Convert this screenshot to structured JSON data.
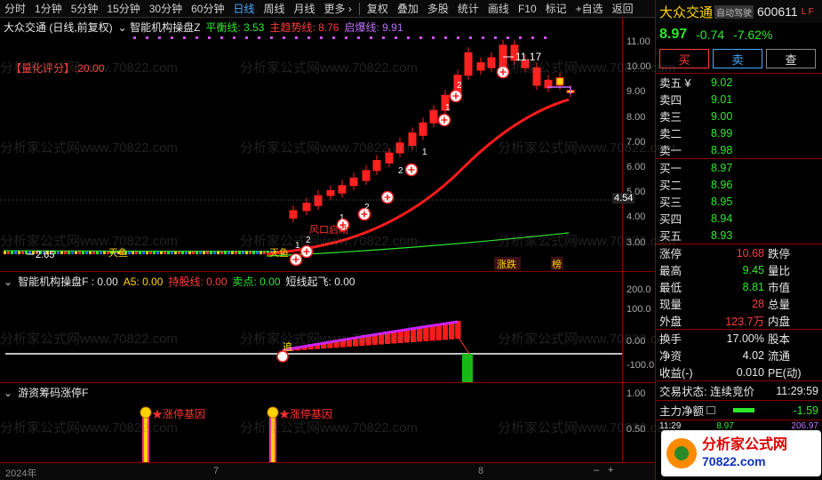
{
  "toolbar": {
    "items": [
      "分时",
      "1分钟",
      "5分钟",
      "15分钟",
      "30分钟",
      "60分钟",
      "日线",
      "周线",
      "月线",
      "更多 ›",
      "复权",
      "叠加",
      "多股",
      "统计",
      "画线",
      "F10",
      "标记",
      "+自选",
      "返回"
    ],
    "active_index": 6
  },
  "main": {
    "stock_title": "大众交通 (日线,前复权)",
    "indicator_name": "智能机构操盘Z",
    "pingheng": "平衡线: 3.53",
    "zhuqushi": "主趋势线: 8.76",
    "qibao": "启爆线: 9.91",
    "score": "【量化评分】:20.00",
    "price_labels": [
      "11.00",
      "10.00",
      "9.00",
      "8.00",
      "7.00",
      "6.00",
      "5.00",
      "4.00",
      "3.00"
    ],
    "current_price_tag": "4.54",
    "high_label": "11.17",
    "low_label": "2.65",
    "fengkou": "风口启动",
    "zhangdie": "涨跌",
    "bang": "榜",
    "tianyu": "天鱼",
    "watermark": "分析家公式网www.70822.com"
  },
  "sub1": {
    "header": [
      "智能机构操盘F : 0.00",
      "A5: 0.00",
      "持股线: 0.00",
      "卖点: 0.00",
      "短线起飞: 0.00"
    ],
    "axis": [
      "200.0",
      "100.0",
      "0.00",
      "-100.0"
    ],
    "zhui": "追"
  },
  "sub2": {
    "header": "游资筹码涨停F",
    "label": "★涨停基因",
    "axis": [
      "1.00",
      "0.50"
    ]
  },
  "timeaxis": {
    "labels": [
      "2024年",
      "7",
      "8"
    ]
  },
  "right": {
    "name": "大众交通",
    "tag": "自动驾驶",
    "code": "600611",
    "flags": "L F",
    "price": "8.97",
    "change": "-0.74",
    "pct": "-7.62%",
    "buy": "买",
    "sell": "卖",
    "query": "查",
    "sells": [
      {
        "label": "卖五 ¥",
        "price": "9.02"
      },
      {
        "label": "卖四",
        "price": "9.01"
      },
      {
        "label": "卖三",
        "price": "9.00"
      },
      {
        "label": "卖二",
        "price": "8.99"
      },
      {
        "label": "卖一",
        "price": "8.98"
      }
    ],
    "buys": [
      {
        "label": "买一",
        "price": "8.97"
      },
      {
        "label": "买二",
        "price": "8.96"
      },
      {
        "label": "买三",
        "price": "8.95"
      },
      {
        "label": "买四",
        "price": "8.94"
      },
      {
        "label": "买五",
        "price": "8.93"
      }
    ],
    "stats": [
      {
        "l": "涨停",
        "v": "10.68",
        "r": "跌停"
      },
      {
        "l": "最高",
        "v": "9.45",
        "r": "量比"
      },
      {
        "l": "最低",
        "v": "8.81",
        "r": "市值"
      },
      {
        "l": "现量",
        "v": "28",
        "r": "总量"
      },
      {
        "l": "外盘",
        "v": "123.7万",
        "r": "内盘"
      }
    ],
    "stats2": [
      {
        "l": "换手",
        "v": "17.00%",
        "r": "股本"
      },
      {
        "l": "净资",
        "v": "4.02",
        "r": "流通"
      },
      {
        "l": "收益(-)",
        "v": "0.010",
        "r": "PE(动)"
      }
    ],
    "trade_state": "交易状态: 连续竞价",
    "time": "11:29:59",
    "fund_label": "主力净额",
    "fund_value": "-1.59",
    "tick_time": "11:29",
    "tick_price": "8.97",
    "tick_vol": "206.97",
    "logo_text": "分析家公式网",
    "logo_url": "70822.com"
  }
}
